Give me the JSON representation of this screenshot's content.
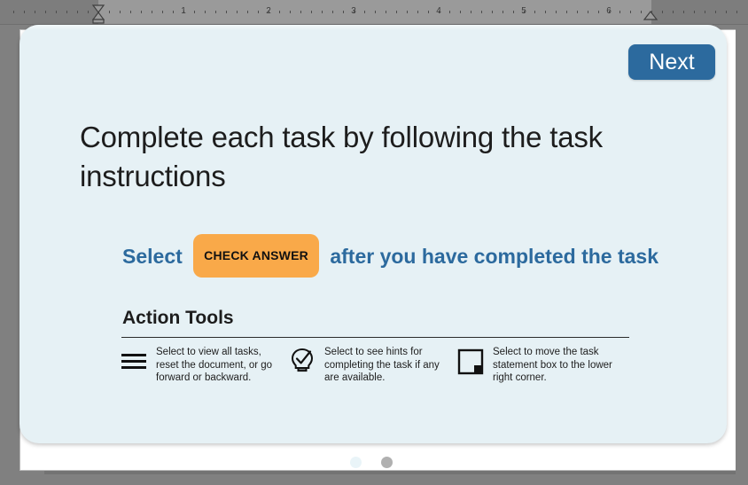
{
  "window": {
    "background_color": "#808080",
    "document_page_color": "#ffffff"
  },
  "ruler": {
    "name": "horizontal-ruler",
    "unit": "inches",
    "numbers": [
      "1",
      "2",
      "3",
      "4",
      "5",
      "6"
    ],
    "left_indent_marker": "hourglass-indent-marker",
    "right_indent_marker": "triangle-indent-marker",
    "background_color": "#8b8b8b",
    "track_color": "#9a9a9a"
  },
  "card": {
    "background_color": "#e6f1f5",
    "next_button": {
      "label": "Next",
      "color": "#2c6a9e"
    },
    "headline": "Complete each task by following the task instructions",
    "select_line": {
      "prefix": "Select",
      "badge": "CHECK ANSWER",
      "badge_color": "#f9a949",
      "suffix": "after you have completed the task",
      "text_color": "#2c6a9e"
    },
    "tools": {
      "heading": "Action Tools",
      "items": [
        {
          "icon": "hamburger-menu-icon",
          "text": "Select to view all tasks, reset the document, or go forward or backward."
        },
        {
          "icon": "lightbulb-check-icon",
          "text": "Select to see hints for completing the task if any are available."
        },
        {
          "icon": "move-box-corner-icon",
          "text": "Select to move the task statement box to the lower right corner."
        }
      ]
    }
  },
  "pagination": {
    "dots": [
      {
        "label": "slide-1",
        "active": true
      },
      {
        "label": "slide-2",
        "active": false
      }
    ]
  }
}
